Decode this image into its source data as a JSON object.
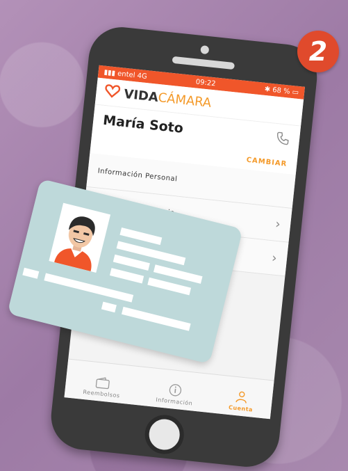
{
  "step_number": "2",
  "status_bar": {
    "carrier": "entel",
    "network": "4G",
    "time": "09:22",
    "battery": "68 %"
  },
  "brand": {
    "vida": "VIDA",
    "camara": "CÁMARA"
  },
  "user": {
    "name": "María Soto",
    "change_label": "CAMBIAR"
  },
  "menu": [
    {
      "label": "Información Personal"
    },
    {
      "label": "Información Bancaria"
    }
  ],
  "tabs": [
    {
      "label": "Reembolsos",
      "icon": "wallet-icon"
    },
    {
      "label": "Información",
      "icon": "info-icon"
    },
    {
      "label": "Cuenta",
      "icon": "person-icon"
    }
  ],
  "colors": {
    "accent": "#f49a2a",
    "status_bar": "#f0562a",
    "badge": "#e04a2c",
    "card": "#bed9da"
  }
}
